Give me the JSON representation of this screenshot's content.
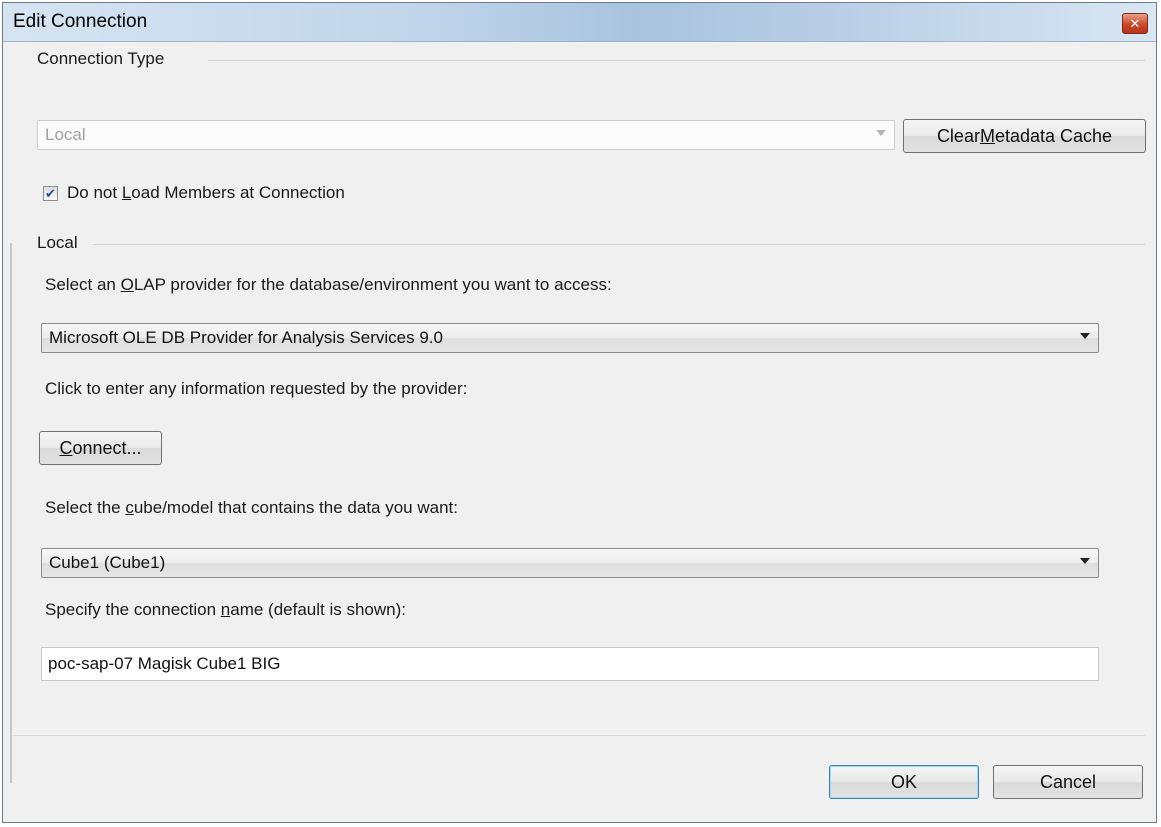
{
  "window": {
    "title": "Edit Connection",
    "close_icon": "close-icon"
  },
  "connection_type": {
    "group_label": "Connection Type",
    "combo_value": "Local",
    "clear_cache_button": {
      "pre": "Clear ",
      "mnemonic": "M",
      "post": "etadata Cache"
    }
  },
  "do_not_load": {
    "checked": true,
    "label": {
      "pre": "Do not ",
      "mnemonic": "L",
      "post": "oad Members at Connection"
    }
  },
  "local": {
    "group_label": "Local",
    "olap_prompt": {
      "pre": "Select an ",
      "mnemonic": "O",
      "post": "LAP provider for the database/environment you want to access:"
    },
    "olap_provider": "Microsoft OLE DB Provider for Analysis Services 9.0",
    "click_prompt": "Click to enter any information requested by the provider:",
    "connect_button": {
      "mnemonic": "C",
      "post": "onnect..."
    },
    "cube_prompt": {
      "pre": "Select the ",
      "mnemonic": "c",
      "post": "ube/model that contains the data you want:"
    },
    "cube_value": "Cube1 (Cube1)",
    "name_prompt": {
      "pre": "Specify the connection ",
      "mnemonic": "n",
      "post": "ame (default is shown):"
    },
    "name_value": "poc-sap-07 Magisk Cube1 BIG"
  },
  "footer": {
    "ok_label": "OK",
    "cancel_label": "Cancel"
  }
}
